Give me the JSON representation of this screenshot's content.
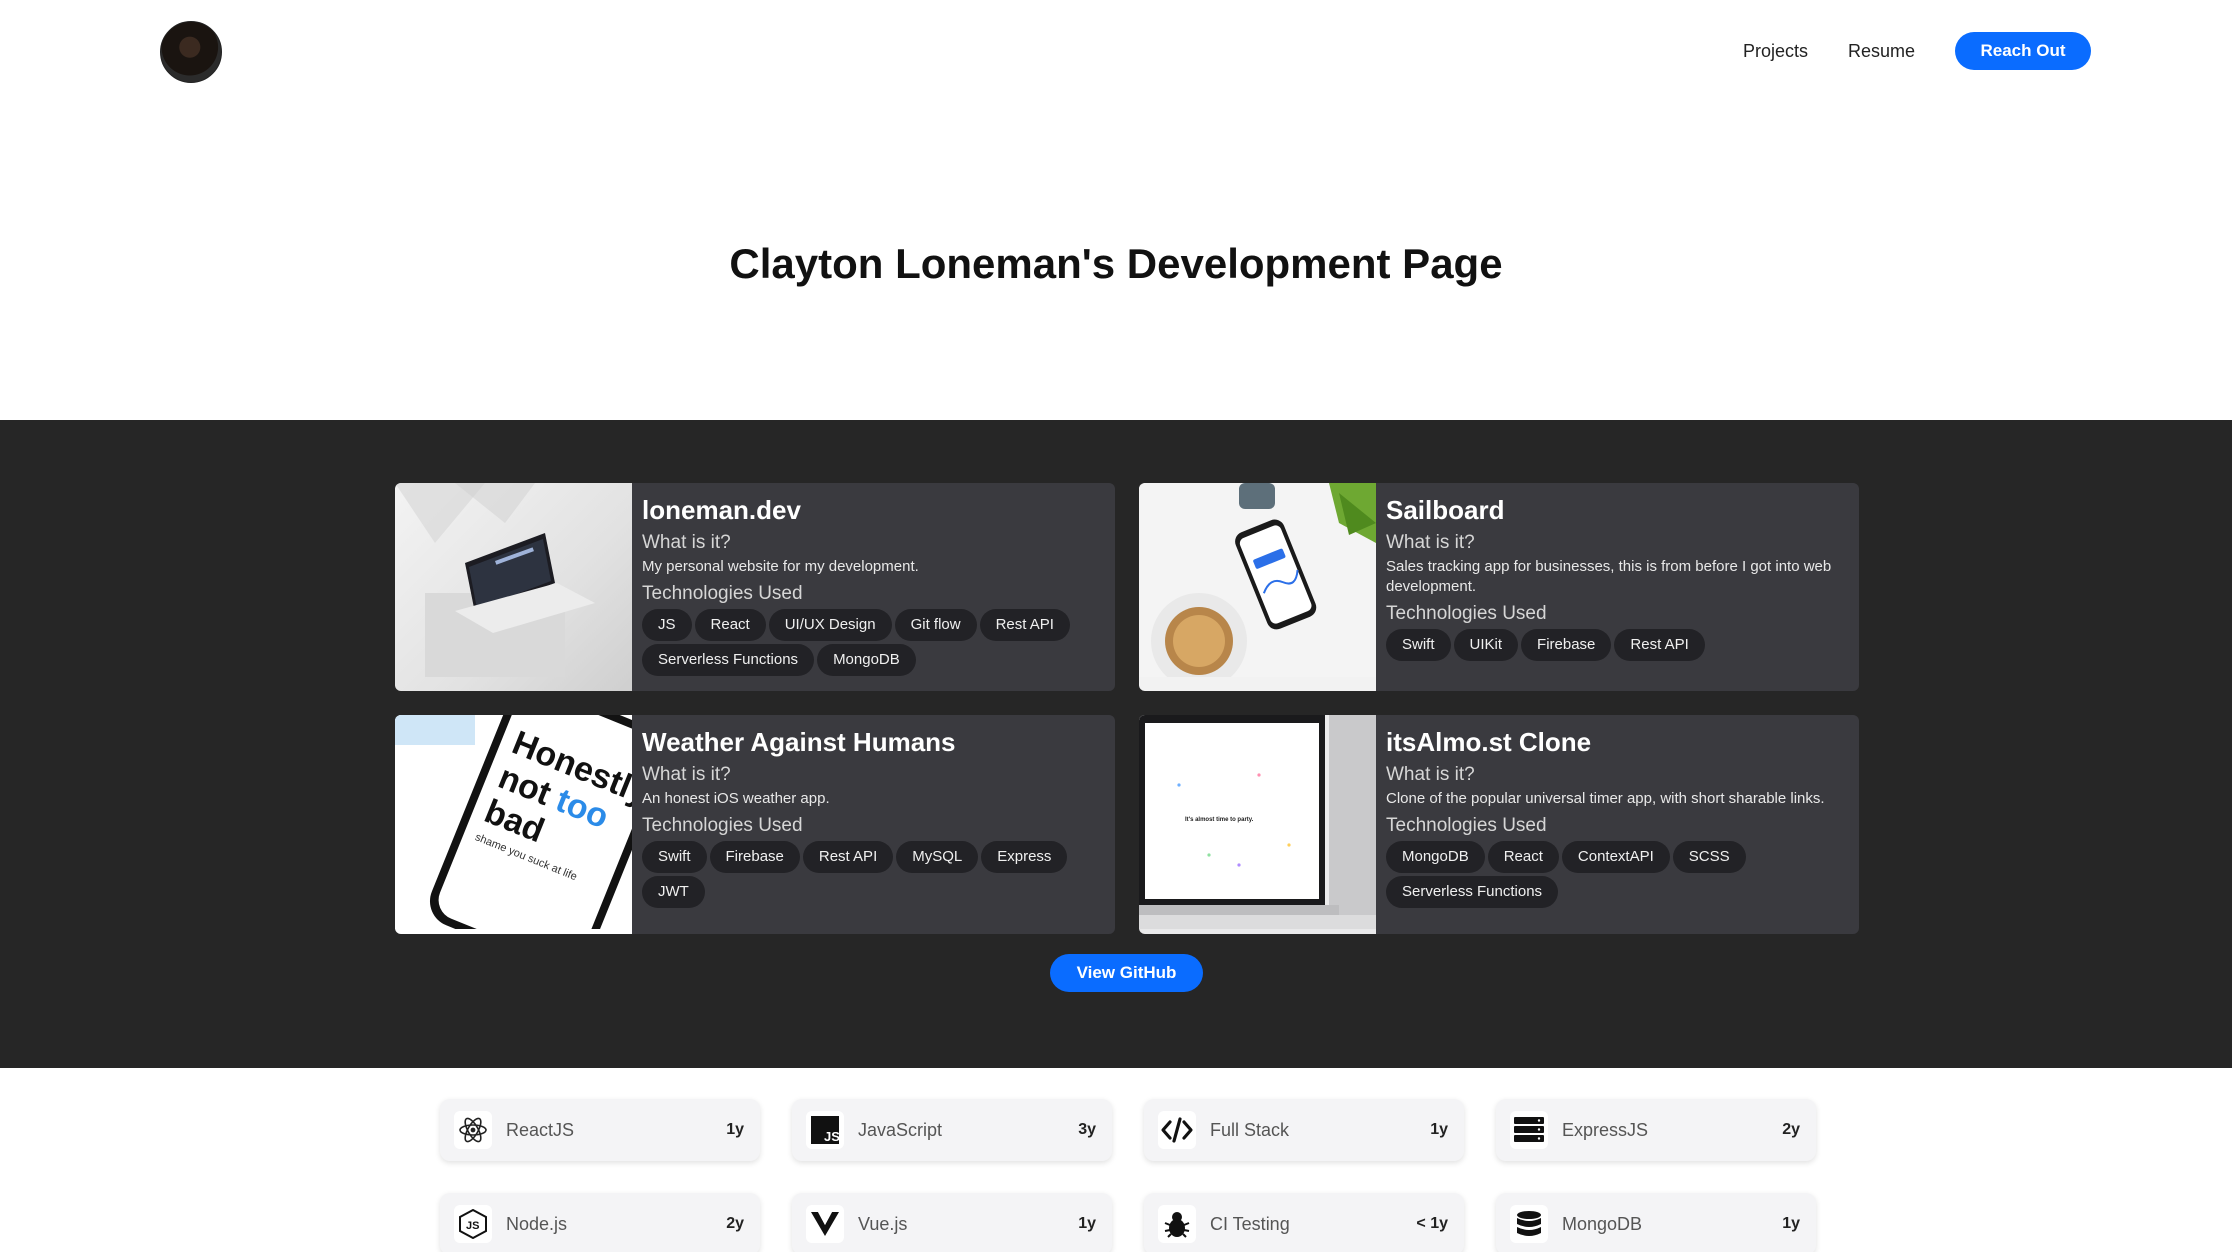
{
  "header": {
    "avatar_alt": "avatar",
    "nav": [
      {
        "label": "Projects"
      },
      {
        "label": "Resume"
      }
    ],
    "cta_label": "Reach Out"
  },
  "page_title": "Clayton Loneman's Development Page",
  "projects": [
    {
      "title": "loneman.dev",
      "what_label": "What is it?",
      "description": "My personal website for my development.",
      "tech_label": "Technologies Used",
      "tags": [
        "JS",
        "React",
        "UI/UX Design",
        "Git flow",
        "Rest API",
        "Serverless Functions",
        "MongoDB"
      ]
    },
    {
      "title": "Sailboard",
      "what_label": "What is it?",
      "description": "Sales tracking app for businesses, this is from before I got into web development.",
      "tech_label": "Technologies Used",
      "tags": [
        "Swift",
        "UIKit",
        "Firebase",
        "Rest API"
      ]
    },
    {
      "title": "Weather Against Humans",
      "what_label": "What is it?",
      "description": "An honest iOS weather app.",
      "tech_label": "Technologies Used",
      "tags": [
        "Swift",
        "Firebase",
        "Rest API",
        "MySQL",
        "Express",
        "JWT"
      ],
      "thumb_text": [
        "Honestly",
        "not",
        "too",
        "bad",
        "shame you suck at life"
      ]
    },
    {
      "title": "itsAlmo.st Clone",
      "what_label": "What is it?",
      "description": "Clone of the popular universal timer app, with short sharable links.",
      "tech_label": "Technologies Used",
      "tags": [
        "MongoDB",
        "React",
        "ContextAPI",
        "SCSS",
        "Serverless Functions"
      ],
      "thumb_text": [
        "It's almost time to party."
      ]
    }
  ],
  "github_label": "View GitHub",
  "skills": [
    {
      "name": "ReactJS",
      "years": "1y",
      "icon": "react-icon"
    },
    {
      "name": "JavaScript",
      "years": "3y",
      "icon": "javascript-icon"
    },
    {
      "name": "Full Stack",
      "years": "1y",
      "icon": "code-icon"
    },
    {
      "name": "ExpressJS",
      "years": "2y",
      "icon": "server-icon"
    },
    {
      "name": "Node.js",
      "years": "2y",
      "icon": "nodejs-icon"
    },
    {
      "name": "Vue.js",
      "years": "1y",
      "icon": "vue-icon"
    },
    {
      "name": "CI Testing",
      "years": "< 1y",
      "icon": "bug-icon"
    },
    {
      "name": "MongoDB",
      "years": "1y",
      "icon": "database-icon"
    }
  ],
  "colors": {
    "accent": "#0a6cff",
    "band": "#262626",
    "card": "#3a3a3f",
    "tag": "#222226"
  }
}
